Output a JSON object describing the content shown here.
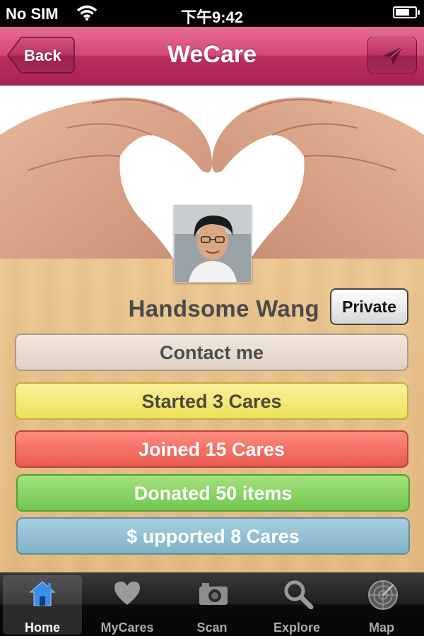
{
  "status_bar": {
    "carrier": "No SIM",
    "time": "下午9:42"
  },
  "nav": {
    "title": "WeCare",
    "back_label": "Back"
  },
  "profile": {
    "name": "Handsome Wang",
    "privacy_label": "Private"
  },
  "stats": {
    "contact": "Contact me",
    "started": "Started 3 Cares",
    "joined": "Joined 15 Cares",
    "donated": "Donated 50 items",
    "supported": "$ upported 8 Cares"
  },
  "tabs": [
    {
      "label": "Home",
      "icon": "home-icon",
      "active": true
    },
    {
      "label": "MyCares",
      "icon": "heart-icon",
      "active": false
    },
    {
      "label": "Scan",
      "icon": "camera-icon",
      "active": false
    },
    {
      "label": "Explore",
      "icon": "magnifier-icon",
      "active": false
    },
    {
      "label": "Map",
      "icon": "radar-icon",
      "active": false
    }
  ],
  "colors": {
    "nav_pink": "#c93a6c",
    "contact": "#e8ddd2",
    "started": "#f3e97b",
    "joined": "#f47366",
    "donated": "#8bd466",
    "supported": "#94c1d3",
    "active_tab_icon": "#3a8ee6"
  }
}
